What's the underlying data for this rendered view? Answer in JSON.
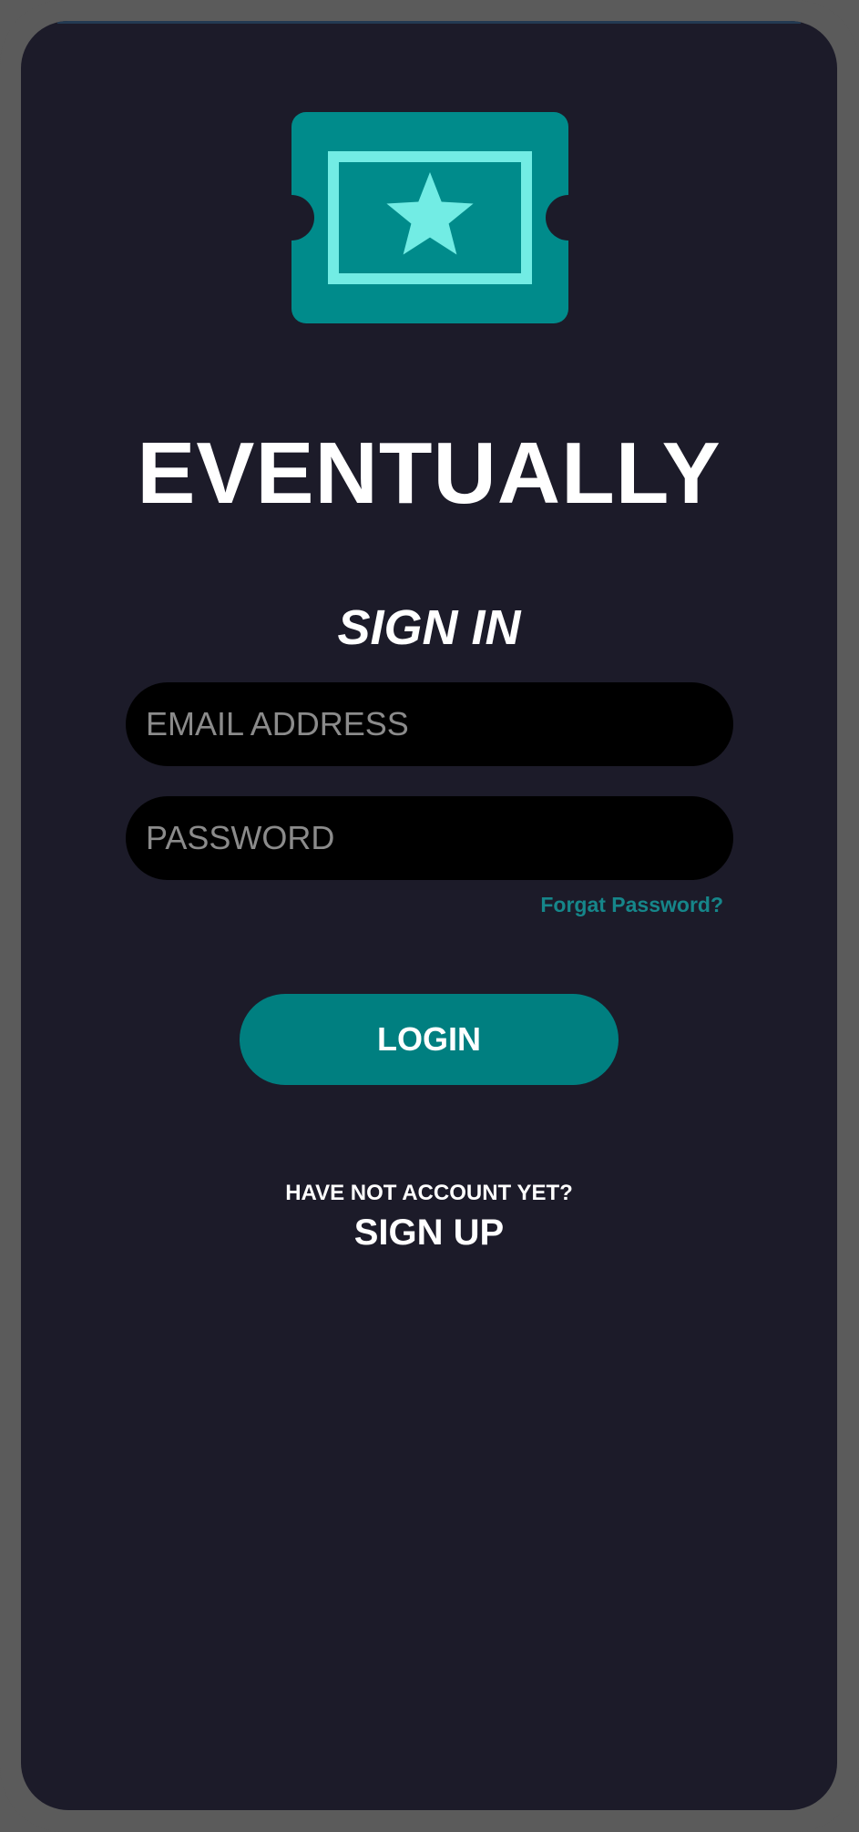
{
  "colors": {
    "frame": "#5b5b5b",
    "screen_background": "#1c1b29",
    "accent": "#007f80",
    "logo_body": "#008b8b",
    "logo_highlight": "#72ece4",
    "forgot_link": "#16868a",
    "input_background": "#000000",
    "placeholder": "#8b8b8b"
  },
  "logo": {
    "icon": "ticket-star-icon"
  },
  "app": {
    "title": "EVENTUALLY"
  },
  "signin": {
    "heading": "SIGN IN",
    "email_placeholder": "EMAIL ADDRESS",
    "email_value": "",
    "password_placeholder": "PASSWORD",
    "password_value": "",
    "forgot_label": "Forgat Password?",
    "login_label": "LOGIN"
  },
  "signup": {
    "prompt": "HAVE NOT ACCOUNT YET?",
    "link_label": "SIGN UP"
  }
}
